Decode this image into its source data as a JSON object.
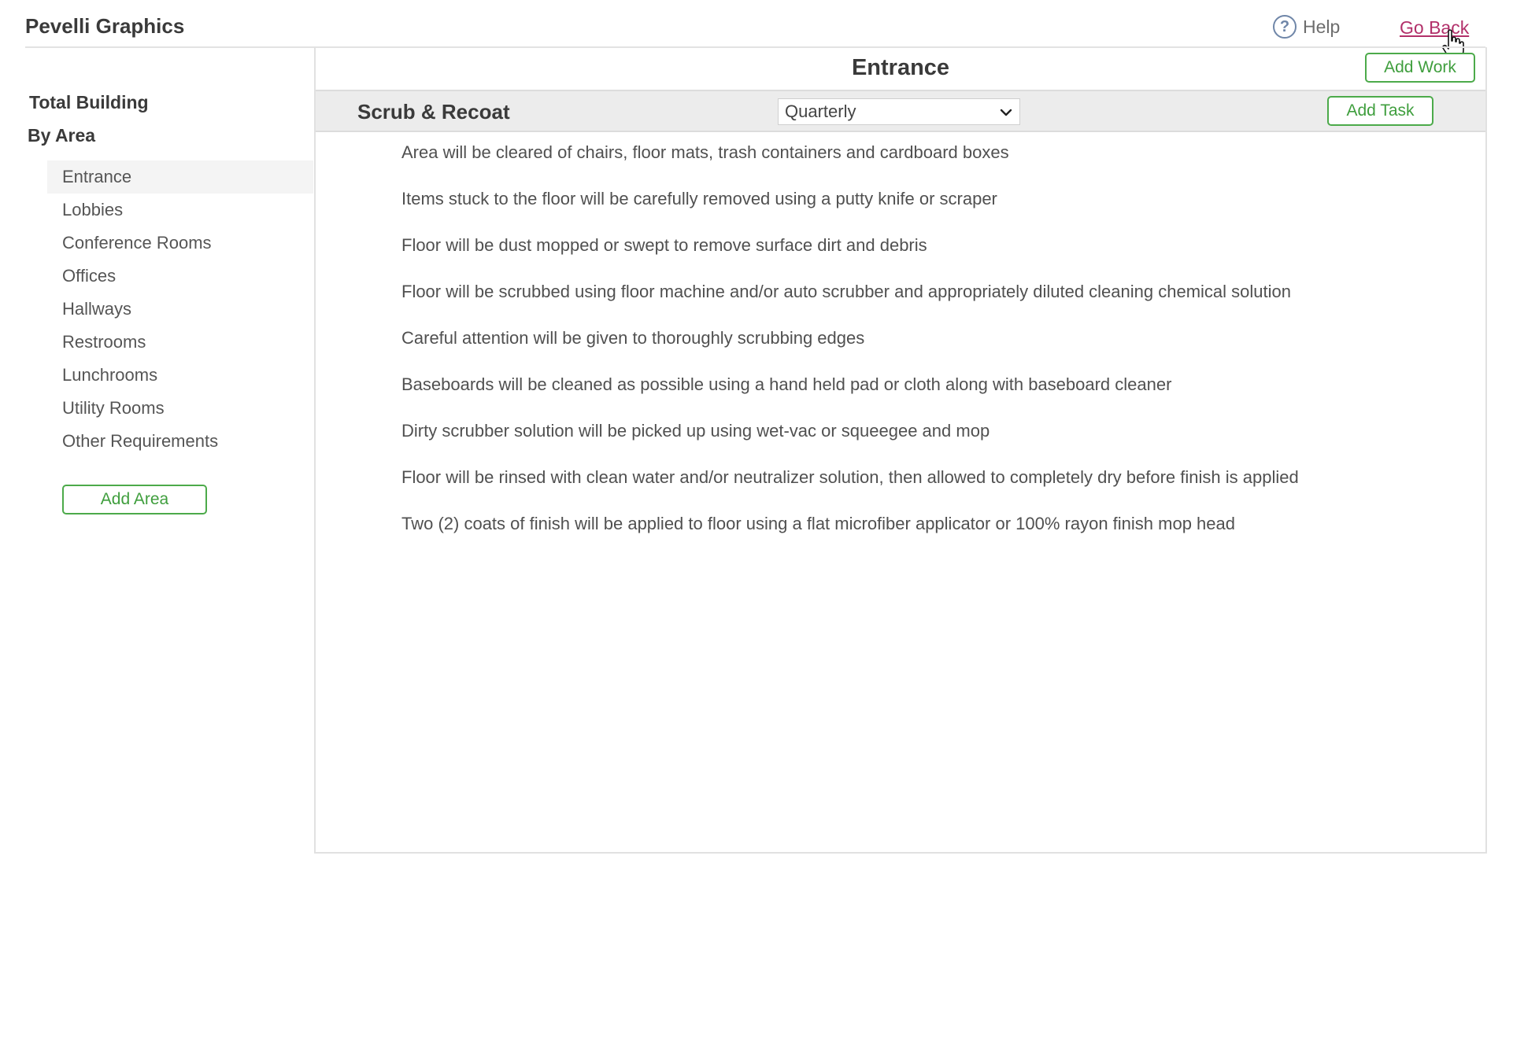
{
  "header": {
    "brand": "Pevelli Graphics",
    "help_label": "Help",
    "go_back_label": "Go Back"
  },
  "sidebar": {
    "total_building": "Total Building",
    "by_area": "By Area",
    "areas": [
      "Entrance",
      "Lobbies",
      "Conference Rooms",
      "Offices",
      "Hallways",
      "Restrooms",
      "Lunchrooms",
      "Utility Rooms",
      "Other Requirements"
    ],
    "active_area": "Entrance",
    "add_area_label": "Add Area"
  },
  "main": {
    "title": "Entrance",
    "add_work_label": "Add Work",
    "work_item": {
      "name": "Scrub & Recoat",
      "frequency": "Quarterly",
      "add_task_label": "Add Task"
    },
    "tasks": [
      "Area will be cleared of chairs, floor mats, trash containers and cardboard boxes",
      "Items stuck to the floor will be carefully removed using a putty knife or scraper",
      "Floor will be dust mopped or swept to remove surface dirt and debris",
      "Floor will be scrubbed using floor machine and/or auto scrubber and appropriately diluted cleaning chemical solution",
      "Careful attention will be given to thoroughly scrubbing edges",
      "Baseboards will be cleaned as possible using a hand held pad or cloth along with baseboard cleaner",
      "Dirty scrubber solution will be picked up using wet-vac or squeegee and mop",
      "Floor will be rinsed with clean water and/or neutralizer solution, then allowed to completely dry before finish is applied",
      "Two (2) coats of finish will be applied to floor using a flat microfiber applicator or 100% rayon finish mop head"
    ]
  },
  "colors": {
    "accent_green": "#4caa4a",
    "link_magenta": "#b2306a",
    "help_blue": "#6f86a8"
  }
}
